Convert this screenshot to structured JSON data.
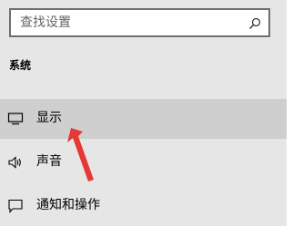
{
  "search": {
    "placeholder": "查找设置",
    "icon": "search-icon"
  },
  "section": {
    "title": "系统"
  },
  "nav_items": [
    {
      "label": "显示",
      "icon": "display-icon",
      "selected": true
    },
    {
      "label": "声音",
      "icon": "speaker-icon",
      "selected": false
    },
    {
      "label": "通知和操作",
      "icon": "notification-icon",
      "selected": false
    }
  ],
  "colors": {
    "background": "#e6e6e6",
    "selected_item": "#cfcfcf",
    "search_border": "#6f6f6f",
    "annotation_arrow": "#e53935"
  }
}
